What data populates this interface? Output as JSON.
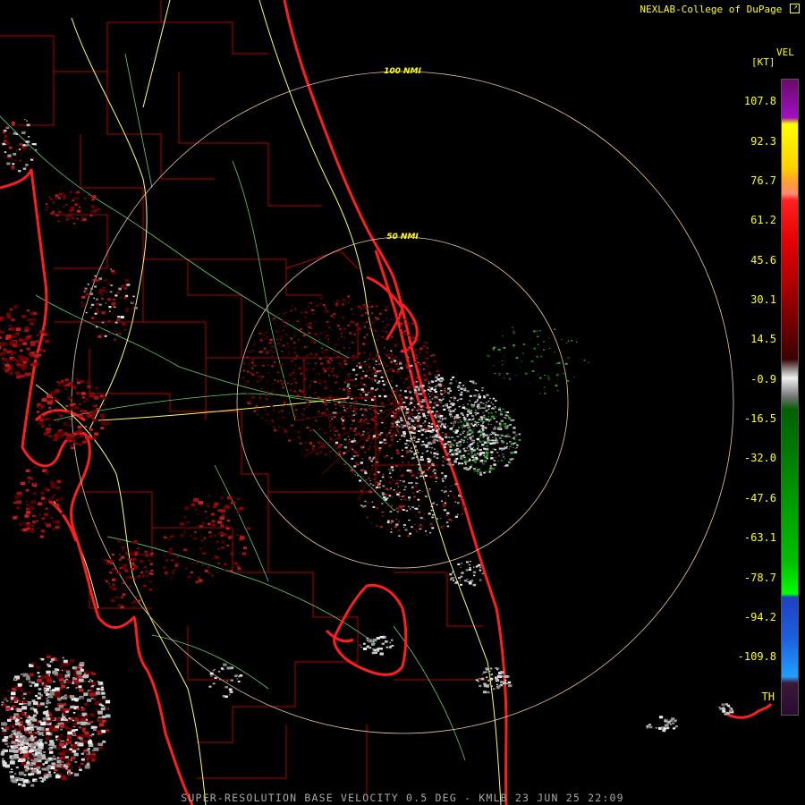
{
  "credit": "NEXLAB-College of DuPage",
  "footer": "SUPER-RESOLUTION BASE VELOCITY 0.5 DEG - KMLB 23 JUN 25 22:09",
  "rings": [
    {
      "label": "100 NMI"
    },
    {
      "label": "50 NMI"
    }
  ],
  "legend": {
    "product": "VEL",
    "unit": "[KT]",
    "ticks": [
      "107.8",
      "92.3",
      "76.7",
      "61.2",
      "45.6",
      "30.1",
      "14.5",
      "-0.9",
      "-16.5",
      "-32.0",
      "-47.6",
      "-63.1",
      "-78.7",
      "-94.2",
      "-109.8",
      "TH"
    ]
  },
  "colors": {
    "coast": "#ff1e1e",
    "county": "#b00000",
    "highway": "#ffff66",
    "road": "#66d06a",
    "ring": "#f0c8a0",
    "label": "#ffff00"
  }
}
